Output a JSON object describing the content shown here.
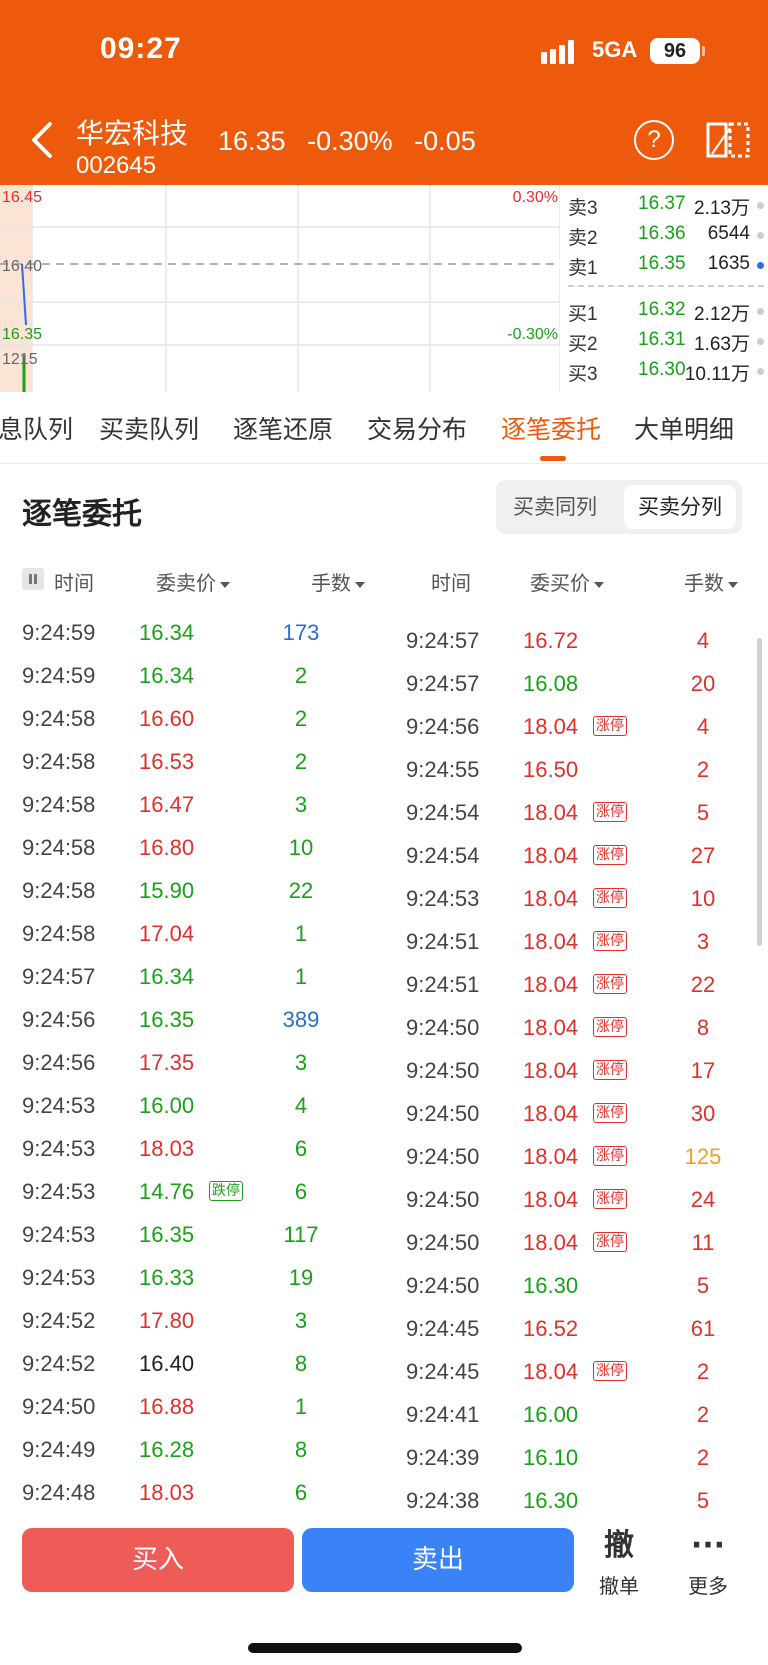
{
  "status_bar": {
    "time": "09:27",
    "network": "5GA",
    "battery": "96"
  },
  "stock": {
    "name": "华宏科技",
    "code": "002645",
    "price": "16.35",
    "change_pct": "-0.30%",
    "change": "-0.05"
  },
  "chart": {
    "price_high": "16.45",
    "price_mid": "16.40",
    "price_low": "16.35",
    "pct_high": "0.30%",
    "pct_low": "-0.30%",
    "volume": "1215",
    "colors": {
      "up": "#e0302a",
      "down": "#1aa01a",
      "line": "#2d6fe6"
    }
  },
  "order_book": {
    "asks": [
      {
        "label": "卖3",
        "price": "16.37",
        "volume": "2.13万"
      },
      {
        "label": "卖2",
        "price": "16.36",
        "volume": "6544"
      },
      {
        "label": "卖1",
        "price": "16.35",
        "volume": "1635"
      }
    ],
    "bids": [
      {
        "label": "买1",
        "price": "16.32",
        "volume": "2.12万"
      },
      {
        "label": "买2",
        "price": "16.31",
        "volume": "1.63万"
      },
      {
        "label": "买3",
        "price": "16.30",
        "volume": "10.11万"
      }
    ]
  },
  "tabs": [
    "息队列",
    "买卖队列",
    "逐笔还原",
    "交易分布",
    "逐笔委托",
    "大单明细"
  ],
  "active_tab": 4,
  "section": {
    "title": "逐笔委托",
    "toggle_same": "买卖同列",
    "toggle_split": "买卖分列"
  },
  "columns": {
    "sell_time": "时间",
    "sell_price": "委卖价",
    "sell_qty": "手数",
    "buy_time": "时间",
    "buy_price": "委买价",
    "buy_qty": "手数"
  },
  "badges": {
    "limit_up": "涨停",
    "limit_down": "跌停"
  },
  "sell_orders": [
    {
      "time": "9:24:59",
      "price": "16.34",
      "qty": "173",
      "pc": "g",
      "qc": "b"
    },
    {
      "time": "9:24:59",
      "price": "16.34",
      "qty": "2",
      "pc": "g",
      "qc": "g"
    },
    {
      "time": "9:24:58",
      "price": "16.60",
      "qty": "2",
      "pc": "r",
      "qc": "g"
    },
    {
      "time": "9:24:58",
      "price": "16.53",
      "qty": "2",
      "pc": "r",
      "qc": "g"
    },
    {
      "time": "9:24:58",
      "price": "16.47",
      "qty": "3",
      "pc": "r",
      "qc": "g"
    },
    {
      "time": "9:24:58",
      "price": "16.80",
      "qty": "10",
      "pc": "r",
      "qc": "g"
    },
    {
      "time": "9:24:58",
      "price": "15.90",
      "qty": "22",
      "pc": "g",
      "qc": "g"
    },
    {
      "time": "9:24:58",
      "price": "17.04",
      "qty": "1",
      "pc": "r",
      "qc": "g"
    },
    {
      "time": "9:24:57",
      "price": "16.34",
      "qty": "1",
      "pc": "g",
      "qc": "g"
    },
    {
      "time": "9:24:56",
      "price": "16.35",
      "qty": "389",
      "pc": "g",
      "qc": "b"
    },
    {
      "time": "9:24:56",
      "price": "17.35",
      "qty": "3",
      "pc": "r",
      "qc": "g"
    },
    {
      "time": "9:24:53",
      "price": "16.00",
      "qty": "4",
      "pc": "g",
      "qc": "g"
    },
    {
      "time": "9:24:53",
      "price": "18.03",
      "qty": "6",
      "pc": "r",
      "qc": "g"
    },
    {
      "time": "9:24:53",
      "price": "14.76",
      "qty": "6",
      "pc": "g",
      "qc": "g",
      "badge": "down"
    },
    {
      "time": "9:24:53",
      "price": "16.35",
      "qty": "117",
      "pc": "g",
      "qc": "g"
    },
    {
      "time": "9:24:53",
      "price": "16.33",
      "qty": "19",
      "pc": "g",
      "qc": "g"
    },
    {
      "time": "9:24:52",
      "price": "17.80",
      "qty": "3",
      "pc": "r",
      "qc": "g"
    },
    {
      "time": "9:24:52",
      "price": "16.40",
      "qty": "8",
      "pc": "k",
      "qc": "g"
    },
    {
      "time": "9:24:50",
      "price": "16.88",
      "qty": "1",
      "pc": "r",
      "qc": "g"
    },
    {
      "time": "9:24:49",
      "price": "16.28",
      "qty": "8",
      "pc": "g",
      "qc": "g"
    },
    {
      "time": "9:24:48",
      "price": "18.03",
      "qty": "6",
      "pc": "r",
      "qc": "g"
    }
  ],
  "buy_orders": [
    {
      "time": "9:24:57",
      "price": "16.72",
      "qty": "4",
      "pc": "r",
      "qc": "r"
    },
    {
      "time": "9:24:57",
      "price": "16.08",
      "qty": "20",
      "pc": "g",
      "qc": "r"
    },
    {
      "time": "9:24:56",
      "price": "18.04",
      "qty": "4",
      "pc": "r",
      "qc": "r",
      "badge": "up"
    },
    {
      "time": "9:24:55",
      "price": "16.50",
      "qty": "2",
      "pc": "r",
      "qc": "r"
    },
    {
      "time": "9:24:54",
      "price": "18.04",
      "qty": "5",
      "pc": "r",
      "qc": "r",
      "badge": "up"
    },
    {
      "time": "9:24:54",
      "price": "18.04",
      "qty": "27",
      "pc": "r",
      "qc": "r",
      "badge": "up"
    },
    {
      "time": "9:24:53",
      "price": "18.04",
      "qty": "10",
      "pc": "r",
      "qc": "r",
      "badge": "up"
    },
    {
      "time": "9:24:51",
      "price": "18.04",
      "qty": "3",
      "pc": "r",
      "qc": "r",
      "badge": "up"
    },
    {
      "time": "9:24:51",
      "price": "18.04",
      "qty": "22",
      "pc": "r",
      "qc": "r",
      "badge": "up"
    },
    {
      "time": "9:24:50",
      "price": "18.04",
      "qty": "8",
      "pc": "r",
      "qc": "r",
      "badge": "up"
    },
    {
      "time": "9:24:50",
      "price": "18.04",
      "qty": "17",
      "pc": "r",
      "qc": "r",
      "badge": "up"
    },
    {
      "time": "9:24:50",
      "price": "18.04",
      "qty": "30",
      "pc": "r",
      "qc": "r",
      "badge": "up"
    },
    {
      "time": "9:24:50",
      "price": "18.04",
      "qty": "125",
      "pc": "r",
      "qc": "o",
      "badge": "up"
    },
    {
      "time": "9:24:50",
      "price": "18.04",
      "qty": "24",
      "pc": "r",
      "qc": "r",
      "badge": "up"
    },
    {
      "time": "9:24:50",
      "price": "18.04",
      "qty": "11",
      "pc": "r",
      "qc": "r",
      "badge": "up"
    },
    {
      "time": "9:24:50",
      "price": "16.30",
      "qty": "5",
      "pc": "g",
      "qc": "r"
    },
    {
      "time": "9:24:45",
      "price": "16.52",
      "qty": "61",
      "pc": "r",
      "qc": "r"
    },
    {
      "time": "9:24:45",
      "price": "18.04",
      "qty": "2",
      "pc": "r",
      "qc": "r",
      "badge": "up"
    },
    {
      "time": "9:24:41",
      "price": "16.00",
      "qty": "2",
      "pc": "g",
      "qc": "r"
    },
    {
      "time": "9:24:39",
      "price": "16.10",
      "qty": "2",
      "pc": "g",
      "qc": "r"
    },
    {
      "time": "9:24:38",
      "price": "16.30",
      "qty": "5",
      "pc": "g",
      "qc": "r"
    }
  ],
  "text_colors": {
    "r": "#e0302a",
    "g": "#1aa01a",
    "b": "#2b6fc4",
    "o": "#f0a020",
    "k": "#222222"
  },
  "bottom": {
    "buy": "买入",
    "sell": "卖出",
    "cancel_big": "撤",
    "cancel": "撤单",
    "more_big": "···",
    "more": "更多"
  }
}
